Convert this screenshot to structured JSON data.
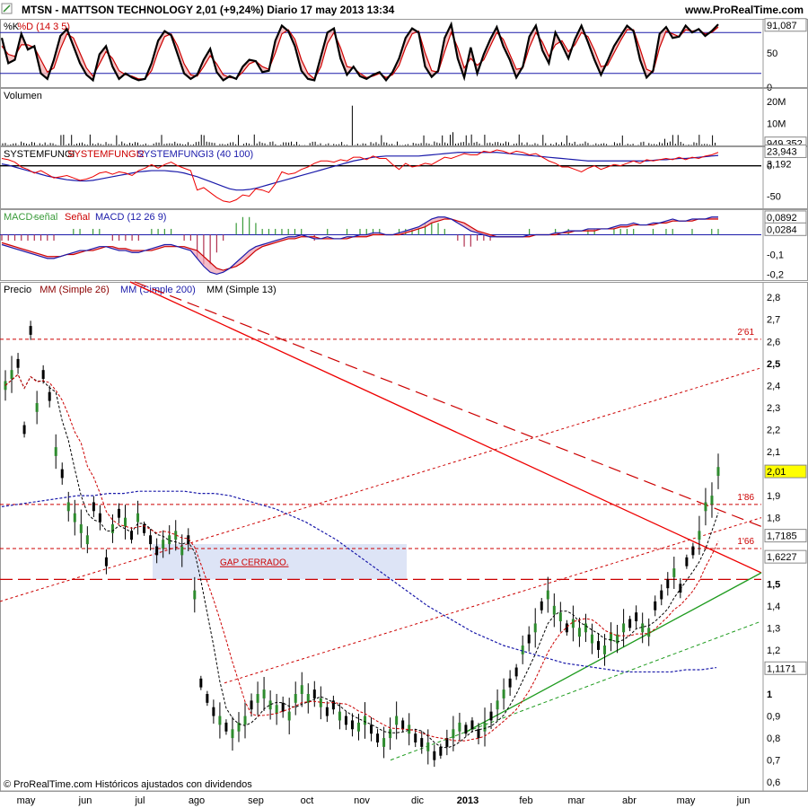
{
  "header": {
    "title": "MTSN - MATTSON TECHNOLOGY    2,01 (+9,24%)    Diario  17 may 2013 13:34",
    "site": "www.ProRealTime.com"
  },
  "footer": {
    "copyright": "© ProRealTime.com  Históricos ajustados con dividendos"
  },
  "colors": {
    "price_up": "#2e8b2e",
    "ma26": "#cc0000",
    "ma200": "#1a1aaa",
    "ma13": "#000000",
    "band": "#dde4f6"
  },
  "chart_data": [
    {
      "type": "line",
      "panel": "stochastic",
      "legend": [
        "%K",
        "%D (14 3 5)"
      ],
      "ylim": [
        0,
        100
      ],
      "yticks": [
        {
          "v": 91.087,
          "label": "91,087",
          "boxed": true
        },
        {
          "v": 50,
          "label": "50"
        },
        {
          "v": 0,
          "label": "0"
        }
      ],
      "levels": [
        80,
        20
      ],
      "k": [
        72,
        35,
        40,
        78,
        55,
        60,
        20,
        12,
        40,
        75,
        85,
        60,
        35,
        18,
        10,
        48,
        60,
        30,
        12,
        20,
        14,
        10,
        12,
        35,
        68,
        82,
        76,
        48,
        20,
        12,
        18,
        40,
        56,
        22,
        10,
        16,
        12,
        30,
        40,
        38,
        22,
        24,
        68,
        90,
        82,
        60,
        24,
        12,
        10,
        45,
        80,
        86,
        42,
        18,
        30,
        16,
        12,
        18,
        22,
        10,
        22,
        42,
        72,
        86,
        80,
        30,
        15,
        24,
        72,
        92,
        42,
        14,
        58,
        20,
        48,
        70,
        88,
        60,
        40,
        14,
        30,
        74,
        90,
        54,
        35,
        80,
        62,
        42,
        70,
        90,
        66,
        40,
        18,
        38,
        60,
        75,
        90,
        82,
        40,
        14,
        24,
        78,
        88,
        72,
        74,
        90,
        80,
        85,
        75,
        82,
        92
      ],
      "d": [
        60,
        48,
        45,
        62,
        62,
        58,
        40,
        22,
        28,
        56,
        78,
        72,
        50,
        28,
        16,
        34,
        52,
        42,
        24,
        18,
        16,
        12,
        12,
        24,
        52,
        74,
        78,
        60,
        34,
        18,
        16,
        30,
        46,
        34,
        18,
        14,
        13,
        22,
        34,
        38,
        30,
        26,
        50,
        78,
        84,
        70,
        40,
        20,
        12,
        30,
        64,
        80,
        58,
        30,
        28,
        20,
        14,
        16,
        20,
        14,
        18,
        32,
        58,
        78,
        82,
        50,
        24,
        22,
        52,
        80,
        58,
        28,
        42,
        32,
        40,
        60,
        80,
        70,
        48,
        26,
        28,
        58,
        80,
        66,
        45,
        62,
        68,
        52,
        62,
        80,
        74,
        54,
        30,
        32,
        50,
        68,
        84,
        84,
        56,
        26,
        22,
        58,
        82,
        78,
        74,
        84,
        82,
        84,
        78,
        80,
        88
      ]
    },
    {
      "type": "bar",
      "panel": "volume",
      "legend": [
        "Volumen"
      ],
      "ylim": [
        0,
        26
      ],
      "yticks": [
        {
          "v": 20,
          "label": "20M"
        },
        {
          "v": 10,
          "label": "10M"
        },
        {
          "v": 0.949,
          "label": "949.352",
          "boxed": true
        }
      ]
    },
    {
      "type": "line",
      "panel": "systemfungi",
      "legend": [
        "SYSTEMFUNGI",
        "SYSTEMFUNGI2",
        "SYSTEMFUNGI3 (40 100)"
      ],
      "ylim": [
        -70,
        32
      ],
      "yticks": [
        {
          "v": 23.943,
          "label": "23,943",
          "boxed": true
        },
        {
          "v": 0,
          "label": "0"
        },
        {
          "v": 3.192,
          "label": "3,192"
        },
        {
          "v": -50,
          "label": "-50"
        }
      ],
      "red": [
        12,
        10,
        6,
        -2,
        -6,
        -12,
        -8,
        -14,
        -20,
        -18,
        -16,
        -20,
        -24,
        -22,
        -18,
        -12,
        -10,
        -14,
        -10,
        -12,
        -16,
        -8,
        -4,
        2,
        -4,
        2,
        6,
        0,
        -4,
        -8,
        -40,
        -36,
        -44,
        -52,
        -58,
        -60,
        -56,
        -48,
        -50,
        -38,
        -40,
        -44,
        -30,
        -10,
        -14,
        -12,
        -6,
        -2,
        4,
        8,
        8,
        6,
        10,
        8,
        14,
        14,
        10,
        16,
        12,
        12,
        2,
        -6,
        4,
        -2,
        0,
        4,
        2,
        8,
        14,
        12,
        16,
        20,
        18,
        18,
        24,
        22,
        26,
        24,
        20,
        24,
        22,
        18,
        20,
        14,
        8,
        4,
        -2,
        -2,
        -6,
        -10,
        -4,
        0,
        -6,
        -2,
        2,
        0,
        4,
        8,
        4,
        10,
        8,
        10,
        12,
        10,
        14,
        10,
        14,
        12,
        16,
        18,
        22
      ],
      "blue": [
        3,
        1,
        -2,
        -5,
        -8,
        -11,
        -14,
        -17,
        -19,
        -21,
        -23,
        -24,
        -25,
        -25,
        -24,
        -22,
        -20,
        -18,
        -16,
        -14,
        -12,
        -10,
        -9,
        -8,
        -8,
        -8,
        -9,
        -10,
        -12,
        -15,
        -18,
        -22,
        -26,
        -30,
        -34,
        -38,
        -40,
        -40,
        -39,
        -37,
        -34,
        -31,
        -28,
        -25,
        -22,
        -19,
        -16,
        -13,
        -10,
        -7,
        -4,
        -1,
        2,
        5,
        8,
        10,
        12,
        14,
        15,
        16,
        16,
        16,
        16,
        16,
        16,
        17,
        18,
        19,
        20,
        21,
        22,
        22,
        22,
        22,
        22,
        22,
        22,
        21,
        20,
        19,
        18,
        17,
        16,
        15,
        14,
        13,
        12,
        11,
        10,
        9,
        8,
        8,
        8,
        8,
        8,
        8,
        8,
        8,
        8,
        8,
        9,
        10,
        10,
        11,
        12,
        12,
        13,
        14,
        15,
        16,
        17
      ]
    },
    {
      "type": "line",
      "panel": "macd",
      "legend": [
        "MACD-",
        "señal",
        "Señal",
        "MACD (12 26 9)"
      ],
      "ylim": [
        -0.23,
        0.13
      ],
      "yticks": [
        {
          "v": 0.0892,
          "label": "0,0892",
          "boxed": true
        },
        {
          "v": 0.0284,
          "label": "0,0284",
          "boxed": true
        },
        {
          "v": -0.1,
          "label": "-0,1"
        },
        {
          "v": -0.2,
          "label": "-0,2"
        }
      ],
      "macd": [
        -0.05,
        -0.06,
        -0.07,
        -0.08,
        -0.09,
        -0.1,
        -0.11,
        -0.12,
        -0.12,
        -0.11,
        -0.1,
        -0.09,
        -0.08,
        -0.08,
        -0.07,
        -0.06,
        -0.06,
        -0.07,
        -0.08,
        -0.08,
        -0.09,
        -0.09,
        -0.08,
        -0.07,
        -0.06,
        -0.05,
        -0.05,
        -0.06,
        -0.07,
        -0.08,
        -0.12,
        -0.16,
        -0.19,
        -0.2,
        -0.19,
        -0.17,
        -0.14,
        -0.11,
        -0.08,
        -0.06,
        -0.05,
        -0.04,
        -0.03,
        -0.02,
        -0.01,
        -0.01,
        0.0,
        -0.01,
        -0.02,
        -0.02,
        -0.01,
        -0.02,
        -0.02,
        -0.01,
        -0.01,
        0.0,
        0.0,
        0.01,
        0.01,
        0.0,
        0.0,
        0.01,
        0.02,
        0.03,
        0.04,
        0.06,
        0.08,
        0.09,
        0.09,
        0.08,
        0.06,
        0.04,
        0.02,
        0.01,
        0.0,
        -0.01,
        -0.01,
        -0.01,
        -0.01,
        -0.01,
        -0.01,
        0.0,
        0.0,
        0.0,
        0.0,
        0.01,
        0.01,
        0.02,
        0.02,
        0.02,
        0.03,
        0.03,
        0.03,
        0.03,
        0.04,
        0.05,
        0.05,
        0.06,
        0.05,
        0.05,
        0.06,
        0.06,
        0.07,
        0.08,
        0.07,
        0.07,
        0.08,
        0.08,
        0.08,
        0.09,
        0.09
      ],
      "signal": [
        -0.04,
        -0.05,
        -0.06,
        -0.07,
        -0.08,
        -0.09,
        -0.1,
        -0.11,
        -0.11,
        -0.11,
        -0.1,
        -0.1,
        -0.09,
        -0.08,
        -0.08,
        -0.07,
        -0.06,
        -0.06,
        -0.07,
        -0.07,
        -0.08,
        -0.08,
        -0.08,
        -0.08,
        -0.07,
        -0.06,
        -0.06,
        -0.06,
        -0.06,
        -0.07,
        -0.08,
        -0.11,
        -0.14,
        -0.17,
        -0.18,
        -0.17,
        -0.16,
        -0.14,
        -0.11,
        -0.08,
        -0.06,
        -0.05,
        -0.04,
        -0.03,
        -0.02,
        -0.02,
        -0.01,
        -0.01,
        -0.01,
        -0.02,
        -0.02,
        -0.02,
        -0.02,
        -0.02,
        -0.01,
        -0.01,
        -0.01,
        0.0,
        0.0,
        0.0,
        0.0,
        0.0,
        0.01,
        0.02,
        0.03,
        0.04,
        0.06,
        0.07,
        0.08,
        0.08,
        0.07,
        0.06,
        0.04,
        0.02,
        0.01,
        0.0,
        -0.01,
        -0.01,
        -0.01,
        -0.01,
        -0.01,
        -0.01,
        0.0,
        0.0,
        0.0,
        0.0,
        0.01,
        0.01,
        0.02,
        0.02,
        0.02,
        0.02,
        0.03,
        0.03,
        0.03,
        0.04,
        0.04,
        0.05,
        0.05,
        0.05,
        0.05,
        0.06,
        0.06,
        0.07,
        0.07,
        0.07,
        0.07,
        0.08,
        0.08,
        0.08,
        0.08
      ]
    },
    {
      "type": "line",
      "panel": "price",
      "legend": [
        "Precio",
        "MM (Simple 26)",
        "MM (Simple 200)",
        "MM (Simple 13)"
      ],
      "ylim": [
        0.56,
        2.87
      ],
      "yticks": [
        {
          "v": 2.8,
          "label": "2,8"
        },
        {
          "v": 2.7,
          "label": "2,7"
        },
        {
          "v": 2.6,
          "label": "2,6"
        },
        {
          "v": 2.5,
          "label": "2,5",
          "bold": true
        },
        {
          "v": 2.4,
          "label": "2,4"
        },
        {
          "v": 2.3,
          "label": "2,3"
        },
        {
          "v": 2.2,
          "label": "2,2"
        },
        {
          "v": 2.1,
          "label": "2,1"
        },
        {
          "v": 2.01,
          "label": "2,01",
          "boxed": true,
          "hl": true
        },
        {
          "v": 1.9,
          "label": "1,9"
        },
        {
          "v": 1.8,
          "label": "1,8"
        },
        {
          "v": 1.7185,
          "label": "1,7185",
          "boxed": true
        },
        {
          "v": 1.6227,
          "label": "1,6227",
          "boxed": true
        },
        {
          "v": 1.5,
          "label": "1,5",
          "bold": true
        },
        {
          "v": 1.4,
          "label": "1,4"
        },
        {
          "v": 1.3,
          "label": "1,3"
        },
        {
          "v": 1.2,
          "label": "1,2"
        },
        {
          "v": 1.1171,
          "label": "1,1171",
          "boxed": true
        },
        {
          "v": 1.0,
          "label": "1",
          "bold": true
        },
        {
          "v": 0.9,
          "label": "0,9"
        },
        {
          "v": 0.8,
          "label": "0,8"
        },
        {
          "v": 0.7,
          "label": "0,7"
        },
        {
          "v": 0.6,
          "label": "0,6"
        }
      ],
      "levels": [
        {
          "v": 2.61,
          "label": "2'61"
        },
        {
          "v": 1.86,
          "label": "1'86"
        },
        {
          "v": 1.66,
          "label": "1'66"
        },
        {
          "v": 1.52,
          "label": ""
        }
      ],
      "gap_label": "GAP CERRADO.",
      "close": [
        2.4,
        2.45,
        2.5,
        2.2,
        2.65,
        2.3,
        2.45,
        2.35,
        2.1,
        2.0,
        1.85,
        1.8,
        1.75,
        1.7,
        1.85,
        1.8,
        1.6,
        1.75,
        1.82,
        1.78,
        1.72,
        1.8,
        1.75,
        1.7,
        1.65,
        1.68,
        1.7,
        1.72,
        1.65,
        1.7,
        1.45,
        1.05,
        0.98,
        0.92,
        0.88,
        0.85,
        0.82,
        0.85,
        0.88,
        0.95,
        0.98,
        1.0,
        0.95,
        0.93,
        0.94,
        0.9,
        0.98,
        1.02,
        0.98,
        1.0,
        0.96,
        0.92,
        0.95,
        0.9,
        0.88,
        0.86,
        0.85,
        0.88,
        0.84,
        0.8,
        0.78,
        0.82,
        0.88,
        0.86,
        0.84,
        0.8,
        0.78,
        0.76,
        0.72,
        0.74,
        0.78,
        0.82,
        0.85,
        0.84,
        0.86,
        0.82,
        0.85,
        0.9,
        0.95,
        1.0,
        1.05,
        1.1,
        1.2,
        1.25,
        1.3,
        1.4,
        1.45,
        1.38,
        1.35,
        1.3,
        1.32,
        1.28,
        1.3,
        1.25,
        1.22,
        1.2,
        1.26,
        1.25,
        1.3,
        1.32,
        1.35,
        1.3,
        1.28,
        1.4,
        1.45,
        1.5,
        1.55,
        1.48,
        1.6,
        1.65,
        1.72,
        1.85,
        1.88,
        2.01
      ],
      "ma200": [
        1.85,
        1.86,
        1.87,
        1.88,
        1.89,
        1.9,
        1.9,
        1.91,
        1.91,
        1.92,
        1.92,
        1.92,
        1.92,
        1.91,
        1.91,
        1.9,
        1.88,
        1.86,
        1.84,
        1.81,
        1.78,
        1.74,
        1.7,
        1.65,
        1.6,
        1.55,
        1.5,
        1.45,
        1.4,
        1.36,
        1.32,
        1.28,
        1.25,
        1.22,
        1.2,
        1.18,
        1.16,
        1.14,
        1.13,
        1.12,
        1.11,
        1.1,
        1.1,
        1.1,
        1.1,
        1.11,
        1.11,
        1.12
      ],
      "trend": "multiple trendlines and channel lines drawn"
    }
  ],
  "xaxis": {
    "labels": [
      "may",
      "jun",
      "jul",
      "ago",
      "sep",
      "oct",
      "nov",
      "dic",
      "2013",
      "feb",
      "mar",
      "abr",
      "may",
      "jun"
    ]
  }
}
